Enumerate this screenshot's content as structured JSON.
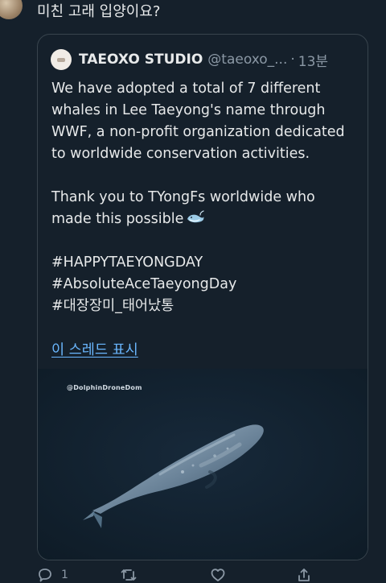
{
  "reply": {
    "text": "미친 고래 입양이요?"
  },
  "quote": {
    "author_name": "TAEOXO STUDIO",
    "handle": "@taeoxo_...",
    "separator": "·",
    "time": "13분",
    "paragraph_1": "We have adopted a total of 7 different whales in Lee Taeyong's name through WWF, a non-profit organization dedicated to worldwide conservation activities.",
    "paragraph_2": "Thank you to TYongFs worldwide who made this possible",
    "hashtag_1": "#HAPPYTAEYONGDAY",
    "hashtag_2": "#AbsoluteAceTaeyongDay",
    "hashtag_3": "#대장장미_태어났통",
    "thread_link": "이 스레드 표시"
  },
  "media": {
    "watermark": "@DolphinDroneDom"
  },
  "actions": {
    "reply_count": "1"
  },
  "colors": {
    "background": "#15202b",
    "text": "#e7e9ea",
    "secondary": "#8b98a5",
    "link": "#6ab7ff",
    "border": "#38444d"
  },
  "icons": {
    "reply": "reply-icon",
    "retweet": "retweet-icon",
    "like": "heart-icon",
    "share": "share-icon",
    "emoji": "whale-emoji-icon"
  }
}
